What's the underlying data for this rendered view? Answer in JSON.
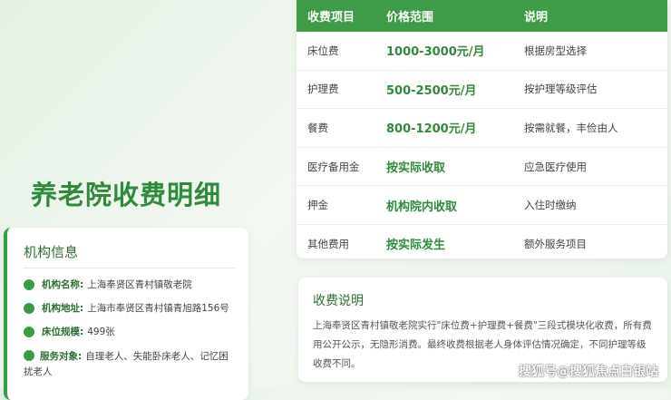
{
  "page_title": "养老院收费明细",
  "info": {
    "title": "机构信息",
    "rows": [
      {
        "key": "机构名称:",
        "value": "上海奉贤区青村镇敬老院"
      },
      {
        "key": "机构地址:",
        "value": "上海市奉贤区青村镇青旭路156号"
      },
      {
        "key": "床位规模:",
        "value": "499张"
      },
      {
        "key": "服务对象:",
        "value": "自理老人、失能卧床老人、记忆困扰老人"
      }
    ]
  },
  "fee_table": {
    "headers": [
      "收费项目",
      "价格范围",
      "说明"
    ],
    "rows": [
      [
        "床位费",
        "1000-3000元/月",
        "根据房型选择"
      ],
      [
        "护理费",
        "500-2500元/月",
        "按护理等级评估"
      ],
      [
        "餐费",
        "800-1200元/月",
        "按需就餐，丰俭由人"
      ],
      [
        "医疗备用金",
        "按实际收取",
        "应急医疗使用"
      ],
      [
        "押金",
        "机构院内收取",
        "入住时缴纳"
      ],
      [
        "其他费用",
        "按实际发生",
        "额外服务项目"
      ]
    ]
  },
  "note": {
    "title": "收费说明",
    "text": "上海奉贤区青村镇敬老院实行\"床位费+护理费+餐费\"三段式模块化收费，所有费用公开公示，无隐形消费。最终收费根据老人身体评估情况确定，不同护理等级收费不同。"
  },
  "watermark": "搜狐号@搜狐焦点白银站",
  "colors": {
    "accent": "#3e9b47",
    "title": "#2f8a3c"
  }
}
